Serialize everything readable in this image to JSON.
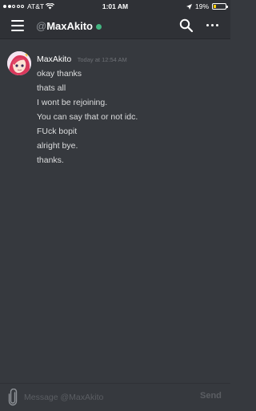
{
  "status_bar": {
    "carrier": "AT&T",
    "time": "1:01 AM",
    "battery_percent": "19%",
    "battery_level": 0.19,
    "signal_bars": 2,
    "battery_color": "#ffcc00"
  },
  "header": {
    "at_symbol": "@",
    "username": "MaxAkito",
    "status_color": "#43b581"
  },
  "icons": {
    "menu": "hamburger-menu-icon",
    "search": "search-icon",
    "more": "more-options-icon",
    "attach": "paperclip-icon",
    "location": "location-arrow-icon",
    "wifi": "wifi-icon"
  },
  "message": {
    "author": "MaxAkito",
    "timestamp": "Today at 12:54 AM",
    "lines": [
      "okay thanks",
      "thats all",
      "I wont be rejoining.",
      "You can say that or not idc.",
      "FUck bopit",
      "alright bye.",
      "thanks."
    ]
  },
  "composer": {
    "placeholder": "Message @MaxAkito",
    "value": "",
    "send_label": "Send"
  },
  "colors": {
    "background": "#36393e",
    "header_bg": "#2f3136",
    "online": "#43b581"
  }
}
